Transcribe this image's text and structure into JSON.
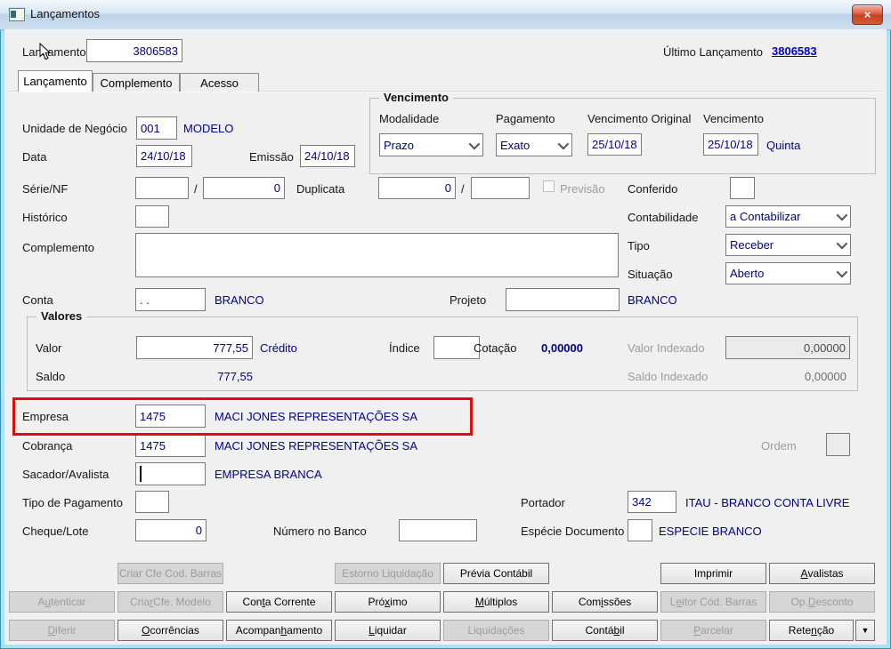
{
  "window": {
    "title": "Lançamentos",
    "close": "×"
  },
  "header": {
    "label": "Lançamento",
    "value": "3806583",
    "last_label": "Último Lançamento",
    "last_value": "3806583"
  },
  "tabs": {
    "active": "Lançamento",
    "items": [
      {
        "label": "Lançamento"
      },
      {
        "label": "Complemento"
      },
      {
        "label": "Acesso"
      }
    ]
  },
  "form": {
    "unidade_negocio": {
      "label": "Unidade de Negócio",
      "value": "001",
      "desc": "MODELO"
    },
    "data": {
      "label": "Data",
      "value": "24/10/18"
    },
    "emissao": {
      "label": "Emissão",
      "value": "24/10/18"
    },
    "vencimento_group": {
      "title": "Vencimento",
      "modalidade": {
        "label": "Modalidade",
        "value": "Prazo"
      },
      "pagamento": {
        "label": "Pagamento",
        "value": "Exato"
      },
      "vencimento_original": {
        "label": "Vencimento Original",
        "value": "25/10/18"
      },
      "vencimento": {
        "label": "Vencimento",
        "value": "25/10/18",
        "weekday": "Quinta"
      }
    },
    "serie_nf": {
      "label": "Série/NF",
      "value1": "",
      "sep": "/",
      "value2": "0"
    },
    "duplicata": {
      "label": "Duplicata",
      "value1": "0",
      "sep": "/",
      "value2": ""
    },
    "previsao": {
      "label": "Previsão",
      "checked": false
    },
    "conferido": {
      "label": "Conferido",
      "value": ""
    },
    "historico": {
      "label": "Histórico",
      "value": ""
    },
    "contabilidade": {
      "label": "Contabilidade",
      "value": "a Contabilizar"
    },
    "complemento": {
      "label": "Complemento",
      "value": ""
    },
    "tipo": {
      "label": "Tipo",
      "value": "Receber"
    },
    "situacao": {
      "label": "Situação",
      "value": "Aberto"
    },
    "conta": {
      "label": "Conta",
      "value": ". .",
      "desc": "BRANCO"
    },
    "projeto": {
      "label": "Projeto",
      "value": "",
      "desc": "BRANCO"
    },
    "valores_group": {
      "title": "Valores",
      "valor": {
        "label": "Valor",
        "value": "777,55",
        "desc": "Crédito"
      },
      "indice": {
        "label": "Índice",
        "value": ""
      },
      "cotacao": {
        "label": "Cotação",
        "value": "0,00000"
      },
      "valor_indexado": {
        "label": "Valor Indexado",
        "value": "0,00000"
      },
      "saldo": {
        "label": "Saldo",
        "value": "777,55"
      },
      "saldo_indexado": {
        "label": "Saldo Indexado",
        "value": "0,00000"
      }
    },
    "empresa": {
      "label": "Empresa",
      "value": "1475",
      "desc": "MACI JONES REPRESENTAÇÕES SA",
      "highlighted": true
    },
    "cobranca": {
      "label": "Cobrança",
      "value": "1475",
      "desc": "MACI JONES REPRESENTAÇÕES SA"
    },
    "ordem": {
      "label": "Ordem",
      "value": ""
    },
    "sacador_avalista": {
      "label": "Sacador/Avalista",
      "value": "",
      "desc": "EMPRESA BRANCA"
    },
    "tipo_pagamento": {
      "label": "Tipo de Pagamento",
      "value": ""
    },
    "portador": {
      "label": "Portador",
      "value": "342",
      "desc": "ITAU - BRANCO CONTA LIVRE"
    },
    "cheque_lote": {
      "label": "Cheque/Lote",
      "value": "0"
    },
    "numero_banco": {
      "label": "Número no Banco",
      "value": ""
    },
    "especie_documento": {
      "label": "Espécie Documento",
      "value": "",
      "desc": "ESPECIE BRANCO"
    }
  },
  "buttons": {
    "grid": [
      {
        "label": "Criar Cfe Cod. Barras",
        "enabled": false
      },
      {
        "label": "Estorno Liquidação",
        "enabled": false
      },
      {
        "label": "Prévia Contábil",
        "enabled": true
      },
      {
        "label": "Imprimir",
        "enabled": true
      },
      {
        "label": "&Avalistas",
        "enabled": true
      },
      {
        "label": "A&utenticar",
        "enabled": false
      },
      {
        "label": "Cria&r Cfe. Modelo",
        "enabled": false
      },
      {
        "label": "Con&ta Corrente",
        "enabled": true
      },
      {
        "label": "Pró&ximo",
        "enabled": true
      },
      {
        "label": "&Múltiplos",
        "enabled": true
      },
      {
        "label": "Com&issões",
        "enabled": true
      },
      {
        "label": "L&eitor Cód. Barras",
        "enabled": false
      },
      {
        "label": "Op.&Desconto",
        "enabled": false
      },
      {
        "label": "&Diferir",
        "enabled": false
      },
      {
        "label": "&Ocorrências",
        "enabled": true
      },
      {
        "label": "Acompan&hamento",
        "enabled": true
      },
      {
        "label": "&Liquidar",
        "enabled": true
      },
      {
        "label": "Liquidações",
        "enabled": false
      },
      {
        "label": "Contá&bil",
        "enabled": true
      },
      {
        "label": "&Parcelar",
        "enabled": false
      },
      {
        "label": "Rete&nção",
        "enabled": true
      },
      {
        "label": "▼",
        "enabled": true
      }
    ]
  },
  "colors": {
    "window_border": "#a9e3f1",
    "background": "#f0f0f0",
    "field_text": "#00008b",
    "link_blue": "#0000cd",
    "highlight_red": "#e00d0d",
    "disabled_text": "#9c9c9c",
    "close_button_red": "#c74124"
  }
}
